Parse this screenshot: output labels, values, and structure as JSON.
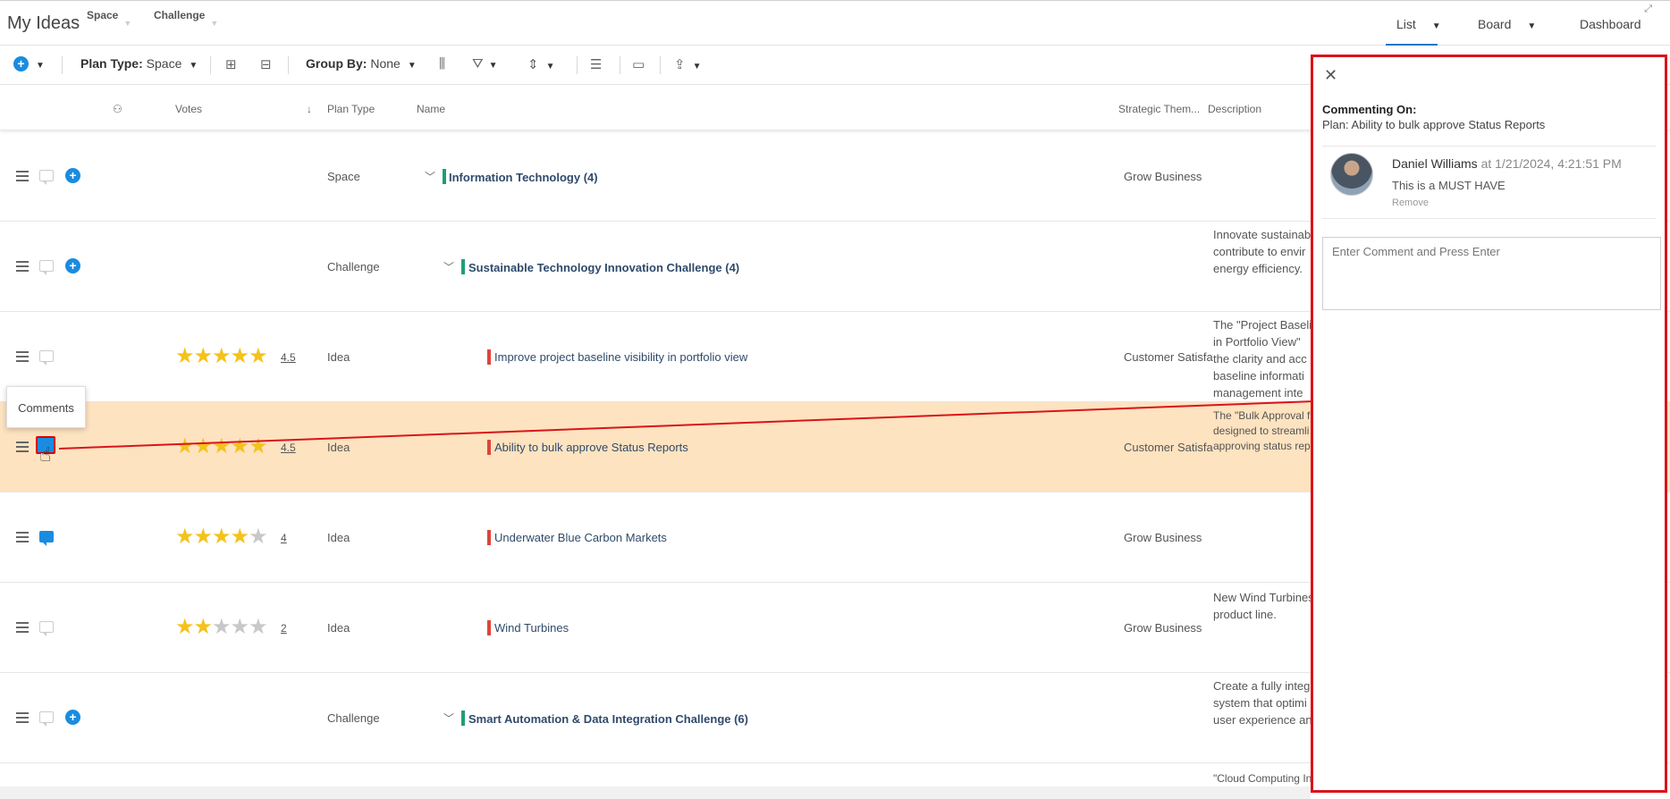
{
  "header": {
    "title": "My Ideas",
    "dropdowns": [
      "Space",
      "Challenge"
    ],
    "views": [
      {
        "label": "List",
        "active": true
      },
      {
        "label": "Board",
        "active": false
      },
      {
        "label": "Dashboard",
        "active": false
      }
    ]
  },
  "toolbar": {
    "plan_type_label": "Plan Type:",
    "plan_type_value": "Space",
    "group_by_label": "Group By:",
    "group_by_value": "None"
  },
  "columns": [
    "Votes",
    "Plan Type",
    "Name",
    "Strategic Them...",
    "Description"
  ],
  "rows": [
    {
      "type": "Space",
      "name": "Information Technology (4)",
      "theme": "Grow Business",
      "desc": [],
      "stars": 0,
      "votes": "",
      "group": true
    },
    {
      "type": "Challenge",
      "name": "Sustainable Technology Innovation Challenge (4)",
      "theme": "",
      "desc": [
        "Innovate sustainab",
        "contribute to envir",
        "energy efficiency."
      ],
      "stars": 0,
      "votes": "",
      "group": true
    },
    {
      "type": "Idea",
      "name": "Improve project baseline visibility in portfolio view",
      "theme": "Customer Satisfa",
      "desc": [
        "The \"Project Baseli",
        "in Portfolio View\"",
        "the clarity and acc",
        "baseline informati",
        "management inte"
      ],
      "stars": 5,
      "votes": "4.5",
      "group": false
    },
    {
      "type": "Idea",
      "name": "Ability to bulk approve Status Reports",
      "theme": "Customer Satisfa",
      "desc": [
        "The \"Bulk Approval f",
        "designed to streamli",
        "approving status rep"
      ],
      "stars": 5,
      "votes": "4.5",
      "group": false
    },
    {
      "type": "Idea",
      "name": "Underwater Blue Carbon Markets",
      "theme": "Grow Business",
      "desc": [],
      "stars": 4,
      "votes": "4",
      "group": false
    },
    {
      "type": "Idea",
      "name": "Wind Turbines",
      "theme": "Grow Business",
      "desc": [
        "New Wind Turbines",
        "product line."
      ],
      "stars": 2,
      "votes": "2",
      "group": false
    },
    {
      "type": "Challenge",
      "name": "Smart Automation & Data Integration Challenge (6)",
      "theme": "",
      "desc": [
        "Create a fully integ",
        "system that optimi",
        "user experience an"
      ],
      "stars": 0,
      "votes": "",
      "group": true
    }
  ],
  "last_row_desc": "\"Cloud Computing In",
  "tooltip": "Comments",
  "panel": {
    "heading": "Commenting On:",
    "subject": "Plan: Ability to bulk approve Status Reports",
    "comment": {
      "author": "Daniel Williams",
      "timestamp": "at 1/21/2024, 4:21:51 PM",
      "text": "This is a MUST HAVE",
      "remove_label": "Remove"
    },
    "input_placeholder": "Enter Comment and Press Enter"
  },
  "colors": {
    "accent": "#1a8ce0",
    "highlight_row": "#fde3c0",
    "annotation": "#d9141b",
    "group_bar": "#1f9d7a",
    "idea_bar": "#e0443a",
    "star": "#f5c21b"
  }
}
